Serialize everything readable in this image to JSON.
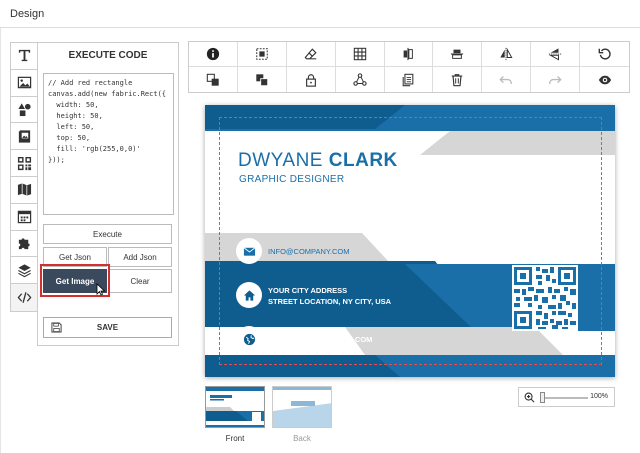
{
  "window": {
    "title": "Design"
  },
  "panel": {
    "title": "EXECUTE CODE",
    "code": "// Add red rectangle\ncanvas.add(new fabric.Rect({\n  width: 50,\n  height: 50,\n  left: 50,\n  top: 50,\n  fill: 'rgb(255,0,0)'\n}));",
    "buttons": {
      "execute": "Execute",
      "get_json": "Get Json",
      "add_json": "Add Json",
      "get_image": "Get Image",
      "clear": "Clear"
    },
    "save": "SAVE"
  },
  "card": {
    "first_name": "DWYANE",
    "last_name": "CLARK",
    "role": "GRAPHIC DESIGNER",
    "email": "INFO@COMPANY.COM",
    "address_line1": "YOUR CITY ADDRESS",
    "address_line2": "STREET LOCATION, NY CITY, USA",
    "website": "WWW.COMPANY-NAME.COM"
  },
  "pages": [
    {
      "label": "Front",
      "active": true
    },
    {
      "label": "Back",
      "active": false
    }
  ],
  "zoom": {
    "value": "100%"
  },
  "colors": {
    "brand_blue": "#1a6fa8",
    "dark_blue": "#0f5d8f",
    "accent_red": "#d32f2f",
    "button_dark": "#3a4a5c"
  }
}
